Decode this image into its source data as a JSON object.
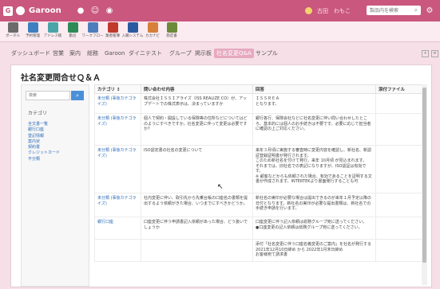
{
  "header": {
    "brand": "Garoon",
    "user_name": "古田　わもこ",
    "search_placeholder": "製品内を検索"
  },
  "apps": [
    {
      "label": "ポータル",
      "color": "#6b6b6b"
    },
    {
      "label": "予約管理",
      "color": "#3f7fbf"
    },
    {
      "label": "アドレス帳",
      "color": "#4aa5a8"
    },
    {
      "label": "勤怠",
      "color": "#2e8b57"
    },
    {
      "label": "ワークフロー",
      "color": "#4e7dbb"
    },
    {
      "label": "業者帳簿",
      "color": "#c0392b"
    },
    {
      "label": "入職システム",
      "color": "#2c5aa0"
    },
    {
      "label": "カカナビ",
      "color": "#d87f3a"
    },
    {
      "label": "勘定書",
      "color": "#6a8a3a"
    }
  ],
  "nav": {
    "tabs": [
      "ダッシュボード",
      "営業",
      "案内",
      "総務",
      "Garoon",
      "ダイニテスト",
      "グループ",
      "掲示板",
      "社名変更Q&A",
      "サンプル"
    ],
    "active": "社名変更Q&A"
  },
  "page": {
    "title": "社名変更問合せＱ＆Ａ"
  },
  "sidebar": {
    "search_placeholder": "検索",
    "heading": "カテゴリ",
    "links": [
      "全文書一覧",
      "銀行口座",
      "登記情報",
      "案内状",
      "契約書",
      "クレジットカード",
      "不分類"
    ]
  },
  "table": {
    "headers": [
      "カテゴリ ↕",
      "問い合わせ内容",
      "回答",
      "添付ファイル"
    ],
    "rows": [
      {
        "category": "未分類 (事後カテゴライズ)",
        "question": "株式会社ＩＳＳＩアライズ（ISS REALIZE CO）が、アップデートでの株式表示は、決まっていますか",
        "answer": "ＩＳＳＲＥＡ\nとなります。",
        "attachment": ""
      },
      {
        "category": "未分類 (事後カテゴライズ)",
        "question": "個人で契約・開設している保険等の住所などについてはどのようにすべきですか。社名変更に伴って変更は必要ですか?",
        "answer": "銀行各行、保険会社などに社名変更に伴い問い合わせしたところ、基本的には個人のお手続きは不要です。必要に応じて担当者に確認の上ご対応ください。",
        "attachment": ""
      },
      {
        "category": "未分類 (事後カテゴライズ)",
        "question": "ISO認定書の社名の変更について",
        "answer": "来年３月頃に実施する審査時に変更内容を確認し、新社名、新認証登録証明書が発行されます。\nこのため新社名を付けて発行。来年 10月頃 が見込まれます。\nそれまでは、旧社名での表記になりますが、ISO認証は有効です。\n※ 顧客などからも依頼された場合、有効であることを証明する文書が作成されます。INTERTEKより書面発行することも可",
        "attachment": ""
      },
      {
        "category": "未分類 (事後カテゴライズ)",
        "question": "社内変更に伴い、取引先から先乗台帳の口座名の書類を提出するよう依頼がきた場合、いつまでにすべきかどうか。",
        "answer": "新社名の実印が必要な場合は提出できるのが来年１月予定以降の日付となります。新社名の実印が必要な提出書類は、新社名での手続き申請を行います。",
        "attachment": ""
      },
      {
        "category": "銀行口座",
        "question": "口座変更に伴う申請書記入依頼があった場合、どう扱いでしょうか",
        "answer": "口座変更に伴う記入依頼は総務グループ宛に送ってください。\n●口座変更の記入依頼は総務グループ宛に送ってください。",
        "attachment": ""
      },
      {
        "category": "",
        "question": "",
        "answer": "添付「社名変更に伴う口座名義変更のご案内」を社名が発行する2021年12月10日締め から 2022年1月末日締め\nお客様宛て請求書",
        "attachment": ""
      }
    ]
  }
}
